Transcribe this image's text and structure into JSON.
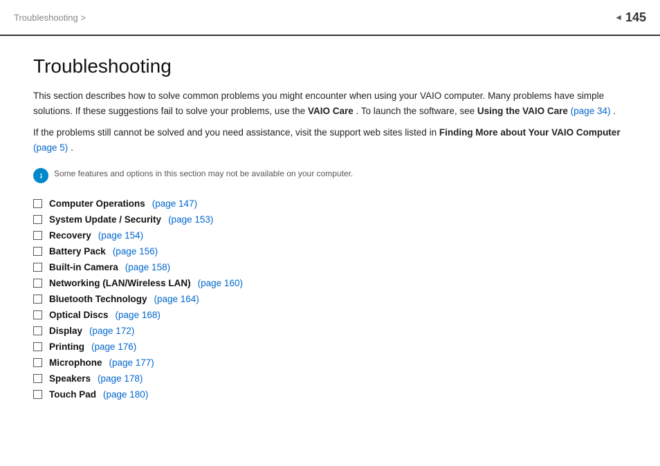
{
  "header": {
    "breadcrumb": "Troubleshooting >",
    "page_number": "145"
  },
  "page": {
    "title": "Troubleshooting",
    "intro_paragraph1_before1": "This section describes how to solve common problems you might encounter when using your VAIO computer. Many problems have simple solutions. If these suggestions fail to solve your problems, use the ",
    "bold1": "VAIO Care",
    "intro_paragraph1_between": ". To launch the software, see ",
    "bold2": "Using the VAIO Care",
    "link1_text": "(page 34)",
    "link1_page": "34",
    "intro_paragraph1_end": ".",
    "intro_paragraph2_before": "If the problems still cannot be solved and you need assistance, visit the support web sites listed in ",
    "bold3": "Finding More about Your VAIO Computer",
    "link2_text": "(page 5)",
    "link2_page": "5",
    "intro_paragraph2_end": ".",
    "note_text": "Some features and options in this section may not be available on your computer.",
    "toc_items": [
      {
        "label": "Computer Operations",
        "link_text": "(page 147)",
        "page": "147"
      },
      {
        "label": "System Update / Security",
        "link_text": "(page 153)",
        "page": "153"
      },
      {
        "label": "Recovery",
        "link_text": "(page 154)",
        "page": "154"
      },
      {
        "label": "Battery Pack",
        "link_text": "(page 156)",
        "page": "156"
      },
      {
        "label": "Built-in Camera",
        "link_text": "(page 158)",
        "page": "158"
      },
      {
        "label": "Networking (LAN/Wireless LAN)",
        "link_text": "(page 160)",
        "page": "160"
      },
      {
        "label": "Bluetooth Technology",
        "link_text": "(page 164)",
        "page": "164"
      },
      {
        "label": "Optical Discs",
        "link_text": "(page 168)",
        "page": "168"
      },
      {
        "label": "Display",
        "link_text": "(page 172)",
        "page": "172"
      },
      {
        "label": "Printing",
        "link_text": "(page 176)",
        "page": "176"
      },
      {
        "label": "Microphone",
        "link_text": "(page 177)",
        "page": "177"
      },
      {
        "label": "Speakers",
        "link_text": "(page 178)",
        "page": "178"
      },
      {
        "label": "Touch Pad",
        "link_text": "(page 180)",
        "page": "180"
      }
    ]
  },
  "colors": {
    "link": "#0066cc",
    "accent": "#0088cc"
  }
}
